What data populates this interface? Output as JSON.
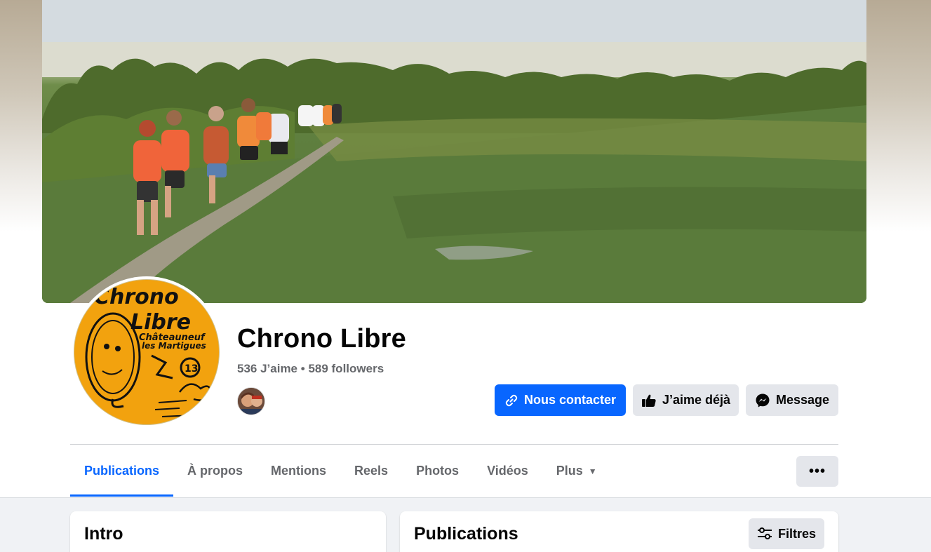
{
  "page": {
    "name": "Chrono Libre",
    "likes": "536 J’aime",
    "separator": "•",
    "followers": "589 followers"
  },
  "profile_logo": {
    "line1": "Chrono",
    "line2": "Libre",
    "line3": "Châteauneuf",
    "line4": "les Martigues",
    "badge": "13"
  },
  "actions": {
    "contact": "Nous contacter",
    "liked": "J’aime déjà",
    "message": "Message"
  },
  "tabs": [
    {
      "label": "Publications",
      "active": true
    },
    {
      "label": "À propos"
    },
    {
      "label": "Mentions"
    },
    {
      "label": "Reels"
    },
    {
      "label": "Photos"
    },
    {
      "label": "Vidéos"
    },
    {
      "label": "Plus"
    }
  ],
  "more_button": "•••",
  "intro": {
    "title": "Intro"
  },
  "posts": {
    "title": "Publications",
    "filter": "Filtres"
  },
  "icons": {
    "contact": "link-icon",
    "liked": "thumbs-up-icon",
    "message": "messenger-icon",
    "plus": "caret-down-icon",
    "filter": "sliders-icon"
  },
  "colors": {
    "accent": "#0866ff",
    "secondary_button": "#e4e6eb",
    "muted_text": "#65676b",
    "page_bg": "#f0f2f5",
    "logo_orange": "#f2a20e"
  }
}
